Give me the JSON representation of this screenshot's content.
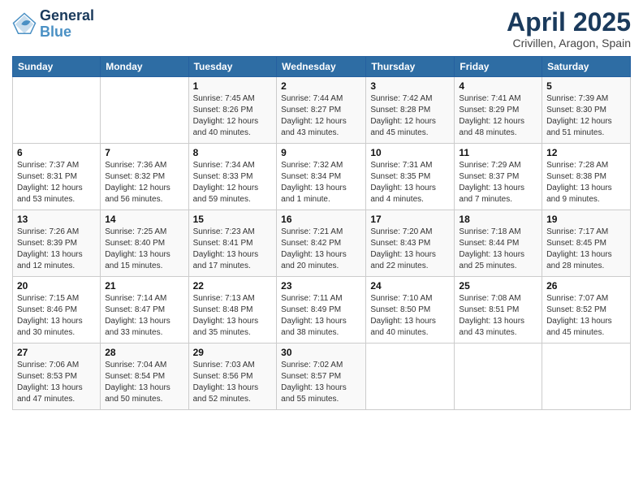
{
  "logo": {
    "text_general": "General",
    "text_blue": "Blue"
  },
  "header": {
    "month": "April 2025",
    "location": "Crivillen, Aragon, Spain"
  },
  "days_of_week": [
    "Sunday",
    "Monday",
    "Tuesday",
    "Wednesday",
    "Thursday",
    "Friday",
    "Saturday"
  ],
  "weeks": [
    [
      {
        "day": "",
        "info": ""
      },
      {
        "day": "",
        "info": ""
      },
      {
        "day": "1",
        "info": "Sunrise: 7:45 AM\nSunset: 8:26 PM\nDaylight: 12 hours and 40 minutes."
      },
      {
        "day": "2",
        "info": "Sunrise: 7:44 AM\nSunset: 8:27 PM\nDaylight: 12 hours and 43 minutes."
      },
      {
        "day": "3",
        "info": "Sunrise: 7:42 AM\nSunset: 8:28 PM\nDaylight: 12 hours and 45 minutes."
      },
      {
        "day": "4",
        "info": "Sunrise: 7:41 AM\nSunset: 8:29 PM\nDaylight: 12 hours and 48 minutes."
      },
      {
        "day": "5",
        "info": "Sunrise: 7:39 AM\nSunset: 8:30 PM\nDaylight: 12 hours and 51 minutes."
      }
    ],
    [
      {
        "day": "6",
        "info": "Sunrise: 7:37 AM\nSunset: 8:31 PM\nDaylight: 12 hours and 53 minutes."
      },
      {
        "day": "7",
        "info": "Sunrise: 7:36 AM\nSunset: 8:32 PM\nDaylight: 12 hours and 56 minutes."
      },
      {
        "day": "8",
        "info": "Sunrise: 7:34 AM\nSunset: 8:33 PM\nDaylight: 12 hours and 59 minutes."
      },
      {
        "day": "9",
        "info": "Sunrise: 7:32 AM\nSunset: 8:34 PM\nDaylight: 13 hours and 1 minute."
      },
      {
        "day": "10",
        "info": "Sunrise: 7:31 AM\nSunset: 8:35 PM\nDaylight: 13 hours and 4 minutes."
      },
      {
        "day": "11",
        "info": "Sunrise: 7:29 AM\nSunset: 8:37 PM\nDaylight: 13 hours and 7 minutes."
      },
      {
        "day": "12",
        "info": "Sunrise: 7:28 AM\nSunset: 8:38 PM\nDaylight: 13 hours and 9 minutes."
      }
    ],
    [
      {
        "day": "13",
        "info": "Sunrise: 7:26 AM\nSunset: 8:39 PM\nDaylight: 13 hours and 12 minutes."
      },
      {
        "day": "14",
        "info": "Sunrise: 7:25 AM\nSunset: 8:40 PM\nDaylight: 13 hours and 15 minutes."
      },
      {
        "day": "15",
        "info": "Sunrise: 7:23 AM\nSunset: 8:41 PM\nDaylight: 13 hours and 17 minutes."
      },
      {
        "day": "16",
        "info": "Sunrise: 7:21 AM\nSunset: 8:42 PM\nDaylight: 13 hours and 20 minutes."
      },
      {
        "day": "17",
        "info": "Sunrise: 7:20 AM\nSunset: 8:43 PM\nDaylight: 13 hours and 22 minutes."
      },
      {
        "day": "18",
        "info": "Sunrise: 7:18 AM\nSunset: 8:44 PM\nDaylight: 13 hours and 25 minutes."
      },
      {
        "day": "19",
        "info": "Sunrise: 7:17 AM\nSunset: 8:45 PM\nDaylight: 13 hours and 28 minutes."
      }
    ],
    [
      {
        "day": "20",
        "info": "Sunrise: 7:15 AM\nSunset: 8:46 PM\nDaylight: 13 hours and 30 minutes."
      },
      {
        "day": "21",
        "info": "Sunrise: 7:14 AM\nSunset: 8:47 PM\nDaylight: 13 hours and 33 minutes."
      },
      {
        "day": "22",
        "info": "Sunrise: 7:13 AM\nSunset: 8:48 PM\nDaylight: 13 hours and 35 minutes."
      },
      {
        "day": "23",
        "info": "Sunrise: 7:11 AM\nSunset: 8:49 PM\nDaylight: 13 hours and 38 minutes."
      },
      {
        "day": "24",
        "info": "Sunrise: 7:10 AM\nSunset: 8:50 PM\nDaylight: 13 hours and 40 minutes."
      },
      {
        "day": "25",
        "info": "Sunrise: 7:08 AM\nSunset: 8:51 PM\nDaylight: 13 hours and 43 minutes."
      },
      {
        "day": "26",
        "info": "Sunrise: 7:07 AM\nSunset: 8:52 PM\nDaylight: 13 hours and 45 minutes."
      }
    ],
    [
      {
        "day": "27",
        "info": "Sunrise: 7:06 AM\nSunset: 8:53 PM\nDaylight: 13 hours and 47 minutes."
      },
      {
        "day": "28",
        "info": "Sunrise: 7:04 AM\nSunset: 8:54 PM\nDaylight: 13 hours and 50 minutes."
      },
      {
        "day": "29",
        "info": "Sunrise: 7:03 AM\nSunset: 8:56 PM\nDaylight: 13 hours and 52 minutes."
      },
      {
        "day": "30",
        "info": "Sunrise: 7:02 AM\nSunset: 8:57 PM\nDaylight: 13 hours and 55 minutes."
      },
      {
        "day": "",
        "info": ""
      },
      {
        "day": "",
        "info": ""
      },
      {
        "day": "",
        "info": ""
      }
    ]
  ]
}
